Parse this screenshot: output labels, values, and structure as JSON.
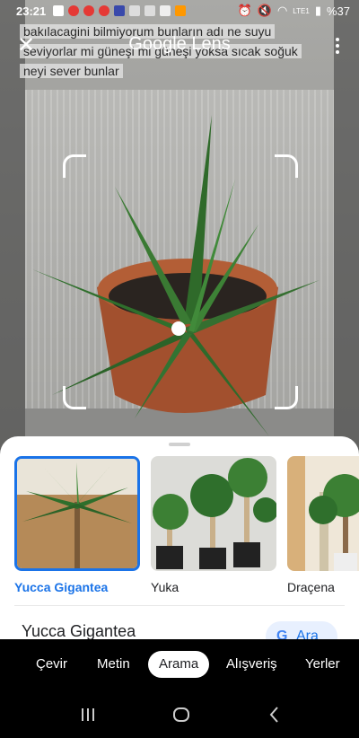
{
  "status_bar": {
    "time": "23:21",
    "battery": "%37",
    "network": "LTE1"
  },
  "overlay_text": {
    "line1": "bakılacagini bilmiyorum bunların adı ne suyu",
    "line2": "seviyorlar mi güneşi mi güneşi yoksa sıcak soğuk",
    "line3": "neyi sever bunlar"
  },
  "header": {
    "title": "Google Lens",
    "close_icon": "close-icon",
    "menu_icon": "more-vert-icon"
  },
  "results": [
    {
      "label": "Yucca Gigantea",
      "selected": true
    },
    {
      "label": "Yuka",
      "selected": false
    },
    {
      "label": "Draçena",
      "selected": false
    }
  ],
  "detail": {
    "title": "Yucca Gigantea",
    "search_button": "Ara",
    "search_icon": "google-g-icon"
  },
  "modes": {
    "translate": "Çevir",
    "text": "Metin",
    "search": "Arama",
    "shopping": "Alışveriş",
    "places": "Yerler",
    "active": "Arama"
  },
  "navbar": {
    "recents": "recents-icon",
    "home": "home-icon",
    "back": "back-icon"
  },
  "colors": {
    "accent": "#1a73e8",
    "sheet": "#ffffff",
    "background": "#000000"
  }
}
